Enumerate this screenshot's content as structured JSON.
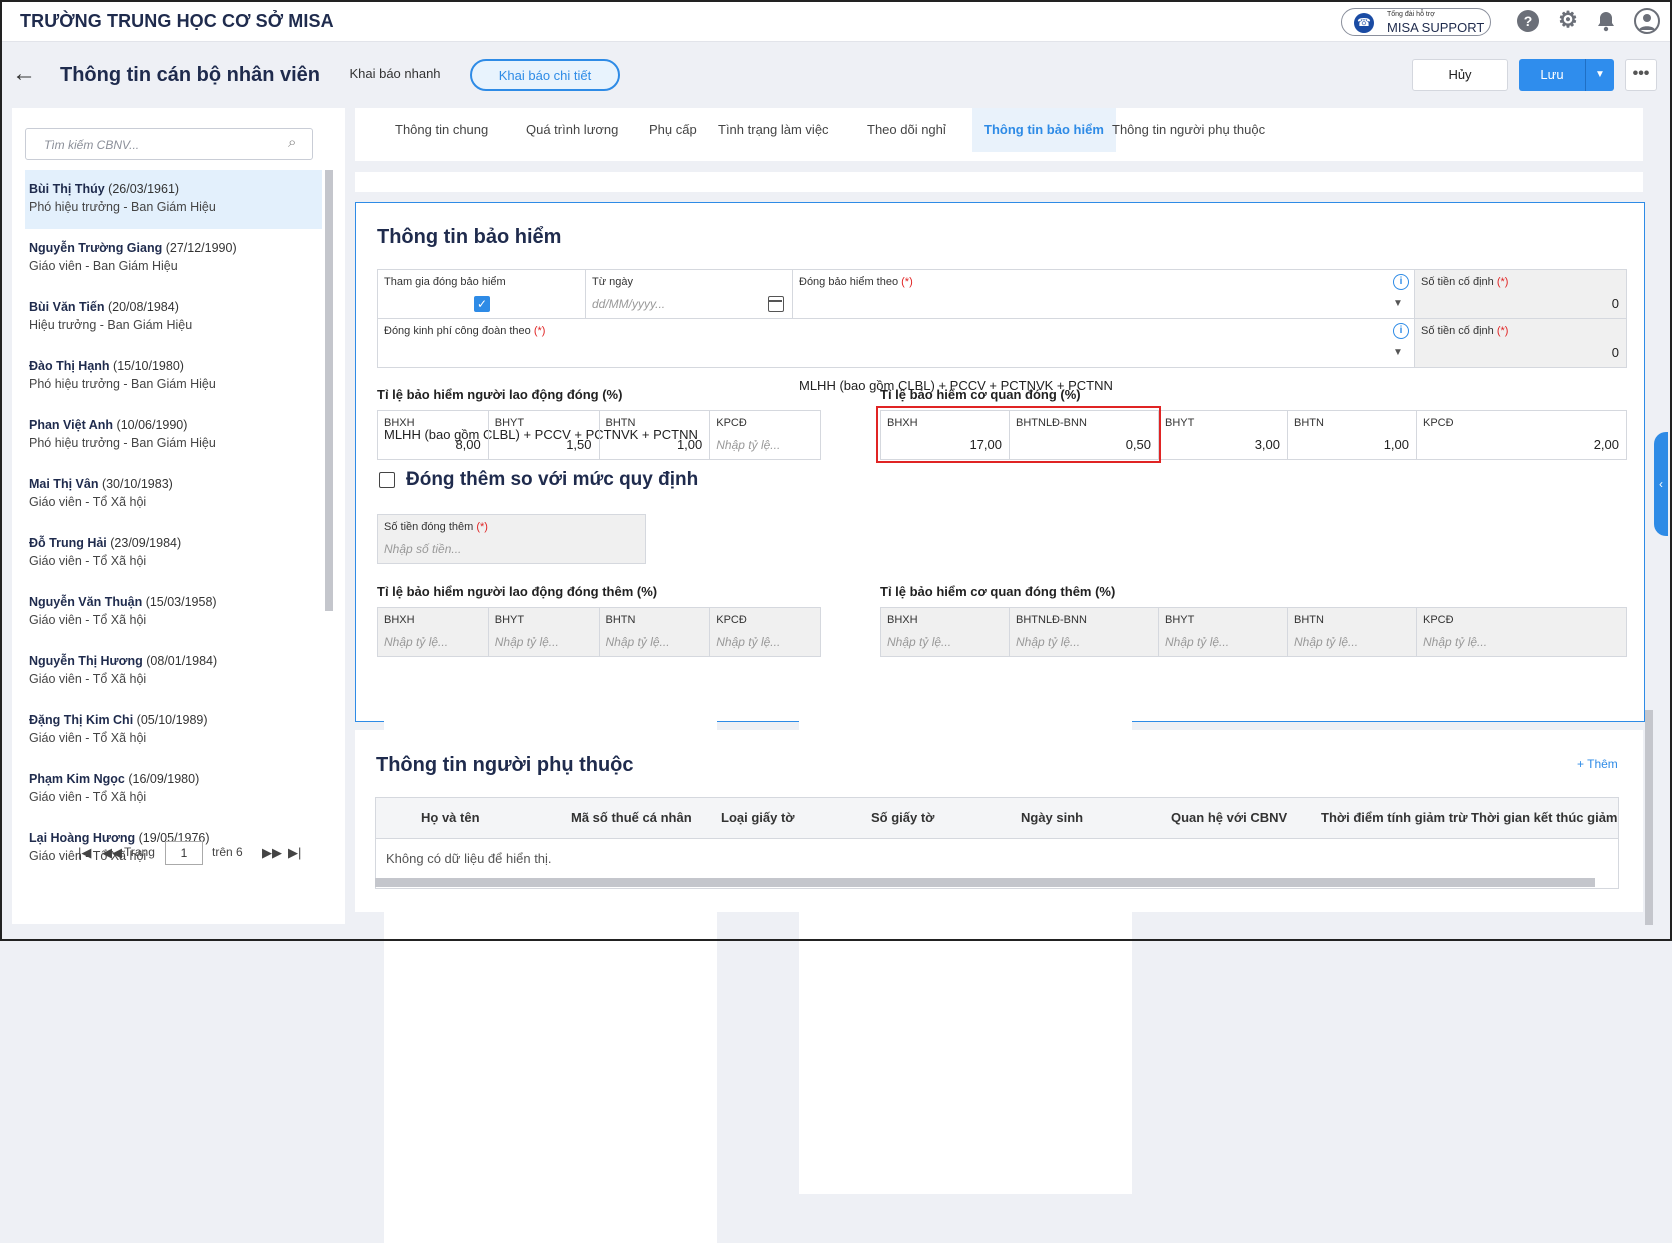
{
  "header": {
    "school": "TRƯỜNG TRUNG HỌC CƠ SỞ MISA",
    "support_small": "Tổng đài hỗ trợ",
    "support_label": "MISA SUPPORT"
  },
  "page": {
    "title": "Thông tin cán bộ nhân viên",
    "mode_quick": "Khai báo nhanh",
    "mode_detail": "Khai báo chi tiết",
    "cancel": "Hủy",
    "save": "Lưu",
    "more": "•••"
  },
  "sidebar": {
    "search_placeholder": "Tìm kiếm CBNV...",
    "employees": [
      {
        "name": "Bùi Thị Thúy",
        "dob": "(26/03/1961)",
        "role": "Phó hiệu trưởng - Ban Giám Hiệu"
      },
      {
        "name": "Nguyễn Trường Giang",
        "dob": "(27/12/1990)",
        "role": "Giáo viên - Ban Giám Hiệu"
      },
      {
        "name": "Bùi Văn Tiến",
        "dob": "(20/08/1984)",
        "role": "Hiệu trưởng - Ban Giám Hiệu"
      },
      {
        "name": "Đào Thị Hạnh",
        "dob": "(15/10/1980)",
        "role": "Phó hiệu trưởng - Ban Giám Hiệu"
      },
      {
        "name": "Phan Việt Anh",
        "dob": "(10/06/1990)",
        "role": "Phó hiệu trưởng - Ban Giám Hiệu"
      },
      {
        "name": "Mai Thị Vân",
        "dob": "(30/10/1983)",
        "role": "Giáo viên - Tổ Xã hội"
      },
      {
        "name": "Đỗ Trung Hải",
        "dob": "(23/09/1984)",
        "role": "Giáo viên - Tổ Xã hội"
      },
      {
        "name": "Nguyễn Văn Thuận",
        "dob": "(15/03/1958)",
        "role": "Giáo viên - Tổ Xã hội"
      },
      {
        "name": "Nguyễn Thị Hương",
        "dob": "(08/01/1984)",
        "role": "Giáo viên - Tổ Xã hội"
      },
      {
        "name": "Đặng Thị Kim Chi",
        "dob": "(05/10/1989)",
        "role": "Giáo viên - Tổ Xã hội"
      },
      {
        "name": "Phạm Kim Ngọc",
        "dob": "(16/09/1980)",
        "role": "Giáo viên - Tổ Xã hội"
      },
      {
        "name": "Lại Hoàng Hương",
        "dob": "(19/05/1976)",
        "role": "Giáo viên - Tổ Xã hội"
      }
    ],
    "pager": {
      "label": "Trang",
      "page": "1",
      "of": "trên 6"
    }
  },
  "tabs": [
    "Thông tin chung",
    "Quá trình lương",
    "Phụ cấp",
    "Tình trạng làm việc",
    "Theo dõi nghỉ",
    "Thông tin bảo hiểm",
    "Thông tin người phụ thuộc"
  ],
  "insurance": {
    "title": "Thông tin bảo hiểm",
    "join_label": "Tham gia đóng bảo hiểm",
    "from_date_label": "Từ ngày",
    "from_date_placeholder": "dd/MM/yyyy...",
    "pay_by_label": "Đóng bảo hiểm theo",
    "pay_by_value": "MLHH (bao gồm CLBL) + PCCV + PCTNVK + PCTNN",
    "fixed_label": "Số tiền cố định",
    "fixed_value": "0",
    "union_label": "Đóng kinh phí công đoàn theo",
    "union_value": "MLHH (bao gồm CLBL) + PCCV + PCTNVK + PCTNN",
    "fixed2_value": "0",
    "required_mark": "(*)",
    "info_mark": "i",
    "employee_rate_title": "Tỉ lệ bảo hiểm người lao động đóng (%)",
    "employee_rates": [
      {
        "label": "BHXH",
        "value": "8,00"
      },
      {
        "label": "BHYT",
        "value": "1,50"
      },
      {
        "label": "BHTN",
        "value": "1,00"
      },
      {
        "label": "KPCĐ",
        "placeholder": "Nhập tỷ lệ..."
      }
    ],
    "employer_rate_title": "Tỉ lệ bảo hiểm cơ quan đóng (%)",
    "employer_rates": [
      {
        "label": "BHXH",
        "value": "17,00"
      },
      {
        "label": "BHTNLĐ-BNN",
        "value": "0,50"
      },
      {
        "label": "BHYT",
        "value": "3,00"
      },
      {
        "label": "BHTN",
        "value": "1,00"
      },
      {
        "label": "KPCĐ",
        "value": "2,00"
      }
    ],
    "extra_title": "Đóng thêm so với mức quy định",
    "extra_amount_label": "Số tiền đóng thêm",
    "extra_amount_placeholder": "Nhập số tiền...",
    "employee_extra_title": "Tỉ lệ bảo hiểm người lao động đóng thêm (%)",
    "employee_extra": [
      "BHXH",
      "BHYT",
      "BHTN",
      "KPCĐ"
    ],
    "employer_extra_title": "Tỉ lệ bảo hiểm cơ quan đóng thêm (%)",
    "employer_extra": [
      "BHXH",
      "BHTNLĐ-BNN",
      "BHYT",
      "BHTN",
      "KPCĐ"
    ],
    "rate_placeholder": "Nhập tỷ lệ..."
  },
  "dependents": {
    "title": "Thông tin người phụ thuộc",
    "add": "+ Thêm",
    "columns": [
      "Họ và tên",
      "Mã số thuế cá nhân",
      "Loại giấy tờ",
      "Số giấy tờ",
      "Ngày sinh",
      "Quan hệ với CBNV",
      "Thời điểm tính giảm trừ",
      "Thời gian kết thúc giảm trừ"
    ],
    "empty": "Không có dữ liệu để hiển thị."
  },
  "colors": {
    "accent": "#2e8be6",
    "highlight": "#e02424",
    "selected_row": "#e3f0fc"
  }
}
